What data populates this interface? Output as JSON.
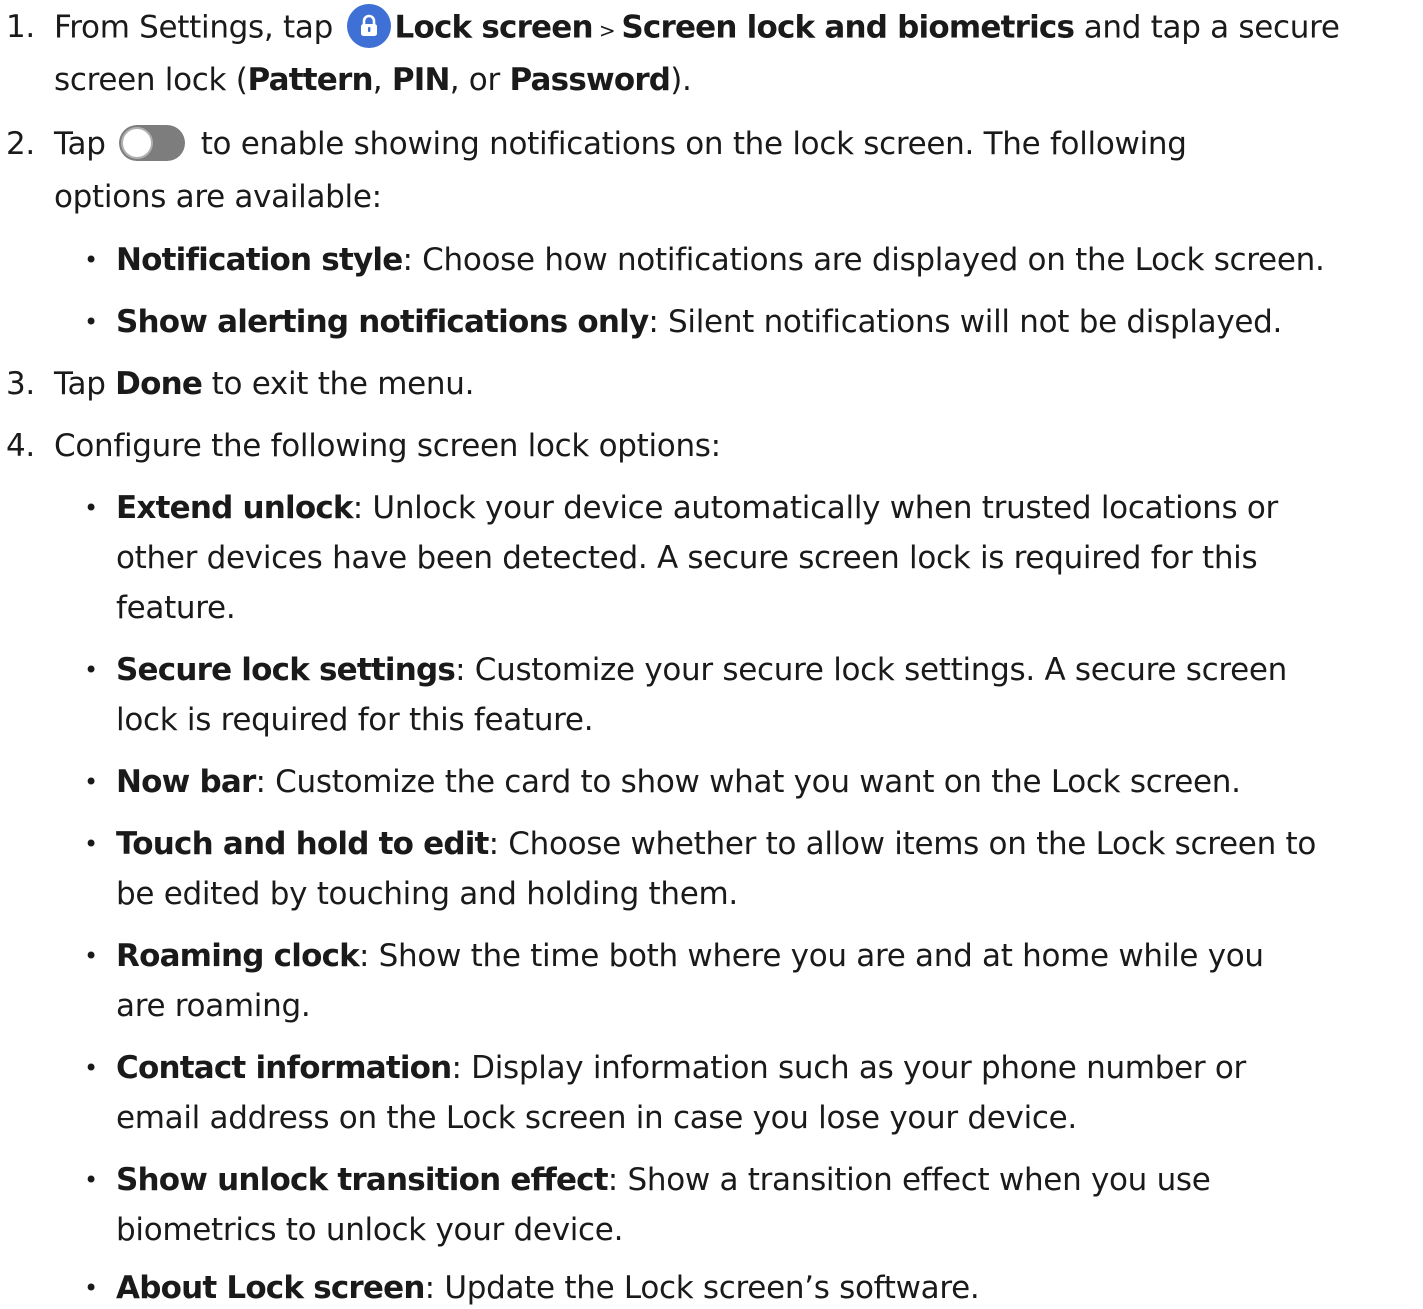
{
  "steps": [
    {
      "num": "1.",
      "pre": "From Settings, tap ",
      "icon": "lock-icon",
      "l1": "Lock screen",
      "gt": " > ",
      "l2": "Screen lock and biometrics",
      "mid": " and tap a secure",
      "line2a": "screen lock (",
      "o1": "Pattern",
      "c1": ", ",
      "o2": "PIN",
      "c2": ", or ",
      "o3": "Password",
      "end": ")."
    },
    {
      "num": "2.",
      "pre": "Tap ",
      "icon": "toggle-icon",
      "post": " to enable showing notifications on the lock screen. The following",
      "line2": "options are available:"
    },
    {
      "num": "3.",
      "pre": "Tap ",
      "bold": "Done",
      "post": " to exit the menu."
    },
    {
      "num": "4.",
      "text": "Configure the following screen lock options:"
    }
  ],
  "step2_bullets": [
    {
      "term": "Notification style",
      "desc": ": Choose how notifications are displayed on the Lock screen."
    },
    {
      "term": "Show alerting notifications only",
      "desc": ": Silent notifications will not be displayed."
    }
  ],
  "step4_bullets": [
    {
      "term": "Extend unlock",
      "line1": ": Unlock your device automatically when trusted locations or",
      "line2": "other devices have been detected. A secure screen lock is required for this",
      "line3": "feature."
    },
    {
      "term": "Secure lock settings",
      "line1": ": Customize your secure lock settings. A secure screen",
      "line2": "lock is required for this feature."
    },
    {
      "term": "Now bar",
      "line1": ": Customize the card to show what you want on the Lock screen."
    },
    {
      "term": "Touch and hold to edit",
      "line1": ": Choose whether to allow items on the Lock screen to",
      "line2": "be edited by touching and holding them."
    },
    {
      "term": "Roaming clock",
      "line1": ": Show the time both where you are and at home while you",
      "line2": "are roaming."
    },
    {
      "term": "Contact information",
      "line1": ": Display information such as your phone number or",
      "line2": "email address on the Lock screen in case you lose your device."
    },
    {
      "term": "Show unlock transition effect",
      "line1": ": Show a transition effect when you use",
      "line2": "biometrics to unlock your device."
    },
    {
      "term": "About Lock screen",
      "line1": ": Update the Lock screen’s software."
    }
  ],
  "bullet_char": "•",
  "colors": {
    "lock_icon_bg": "#3f70d6",
    "toggle_bg": "#7d7d7d"
  }
}
